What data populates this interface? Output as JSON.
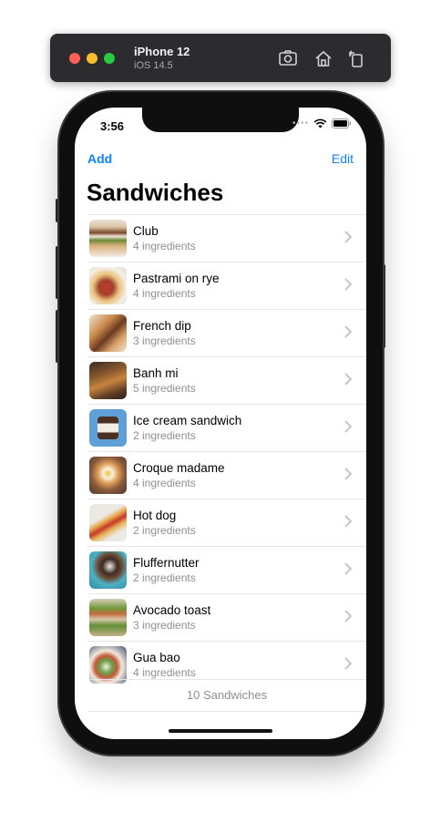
{
  "simulator": {
    "device_name": "iPhone 12",
    "os_version": "iOS 14.5"
  },
  "status_bar": {
    "time": "3:56"
  },
  "nav": {
    "add_label": "Add",
    "edit_label": "Edit",
    "title": "Sandwiches"
  },
  "sandwiches": [
    {
      "name": "Club",
      "ingredients": "4 ingredients"
    },
    {
      "name": "Pastrami on rye",
      "ingredients": "4 ingredients"
    },
    {
      "name": "French dip",
      "ingredients": "3 ingredients"
    },
    {
      "name": "Banh mi",
      "ingredients": "5 ingredients"
    },
    {
      "name": "Ice cream sandwich",
      "ingredients": "2 ingredients"
    },
    {
      "name": "Croque madame",
      "ingredients": "4 ingredients"
    },
    {
      "name": "Hot dog",
      "ingredients": "2 ingredients"
    },
    {
      "name": "Fluffernutter",
      "ingredients": "2 ingredients"
    },
    {
      "name": "Avocado toast",
      "ingredients": "3 ingredients"
    },
    {
      "name": "Gua bao",
      "ingredients": "4 ingredients"
    }
  ],
  "footer": {
    "count_label": "10 Sandwiches"
  },
  "colors": {
    "accent": "#0a84ff",
    "secondary_text": "#8e8e93",
    "separator": "#e6e6e8"
  }
}
